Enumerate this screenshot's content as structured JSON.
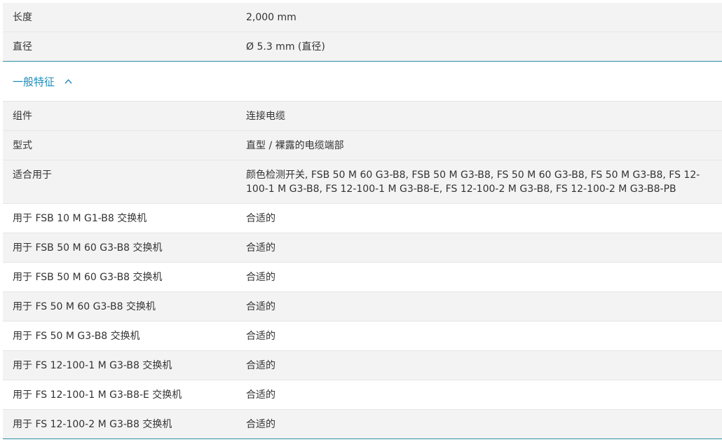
{
  "dimensions_rows": [
    {
      "label": "长度",
      "value": "2,000 mm"
    },
    {
      "label": "直径",
      "value": "Ø 5.3 mm (直径)"
    }
  ],
  "section": {
    "title": "一般特征",
    "toggle_icon": "chevron-up-icon"
  },
  "feature_rows": [
    {
      "label": "组件",
      "value": "连接电缆"
    },
    {
      "label": "型式",
      "value": "直型 / 裸露的电缆端部"
    },
    {
      "label": "适合用于",
      "value": "颜色检测开关, FSB 50 M 60 G3-B8, FSB 50 M G3-B8, FS 50 M 60 G3-B8, FS 50 M G3-B8, FS 12-100-1 M G3-B8, FS 12-100-1 M G3-B8-E, FS 12-100-2 M G3-B8, FS 12-100-2 M G3-B8-PB"
    },
    {
      "label": "用于 FSB 10 M G1-B8 交换机",
      "value": "合适的"
    },
    {
      "label": "用于 FSB 50 M 60 G3-B8 交换机",
      "value": "合适的"
    },
    {
      "label": "用于 FSB 50 M 60 G3-B8 交换机",
      "value": "合适的"
    },
    {
      "label": "用于 FS 50 M 60 G3-B8 交换机",
      "value": "合适的"
    },
    {
      "label": "用于 FS 50 M G3-B8 交换机",
      "value": "合适的"
    },
    {
      "label": "用于 FS 12-100-1 M G3-B8 交换机",
      "value": "合适的"
    },
    {
      "label": "用于 FS 12-100-1 M G3-B8-E 交换机",
      "value": "合适的"
    },
    {
      "label": "用于 FS 12-100-2 M G3-B8 交换机",
      "value": "合适的"
    }
  ],
  "colors": {
    "accent": "#1f8db8",
    "divider": "#2a8fa6",
    "row_alt": "#f3f3f3"
  }
}
